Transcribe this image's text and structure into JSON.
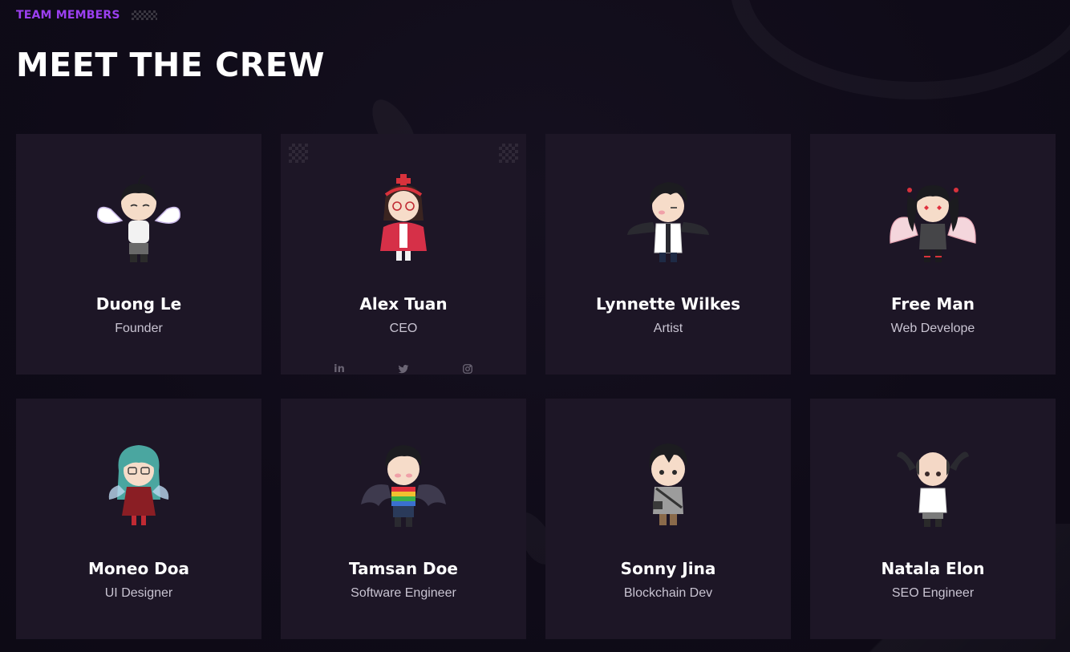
{
  "section": {
    "eyebrow": "TEAM MEMBERS",
    "title": "MEET THE CREW"
  },
  "colors": {
    "accent": "#9b3ff0",
    "card_bg": "#1d1626",
    "page_bg": "#0f0b18"
  },
  "members": [
    {
      "name": "Duong Le",
      "role": "Founder",
      "avatar": "chibi-angel-wings-white-shirt"
    },
    {
      "name": "Alex Tuan",
      "role": "CEO",
      "avatar": "chibi-red-jacket-glasses-nurse-hat",
      "socials": [
        "linkedin-icon",
        "twitter-icon",
        "instagram-icon"
      ],
      "socials_text": {
        "linkedin": "in"
      }
    },
    {
      "name": "Lynnette Wilkes",
      "role": "Artist",
      "avatar": "chibi-dark-wings-lab-coat"
    },
    {
      "name": "Free Man",
      "role": "Web Develope",
      "avatar": "chibi-pink-wings-twin-tails"
    },
    {
      "name": "Moneo Doa",
      "role": "UI Designer",
      "avatar": "chibi-teal-hair-red-dress"
    },
    {
      "name": "Tamsan Doe",
      "role": "Software Engineer",
      "avatar": "chibi-bat-wings-striped-sweater"
    },
    {
      "name": "Sonny Jina",
      "role": "Blockchain Dev",
      "avatar": "chibi-gray-jacket-bag"
    },
    {
      "name": "Natala Elon",
      "role": "SEO Engineer",
      "avatar": "chibi-bald-dark-wings"
    }
  ]
}
